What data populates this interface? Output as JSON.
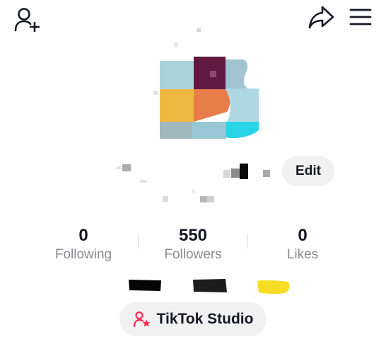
{
  "header": {
    "add_friend_icon": "person-plus-icon",
    "share_icon": "share-arrow-icon",
    "menu_icon": "hamburger-menu-icon"
  },
  "profile": {
    "edit_label": "Edit"
  },
  "stats": [
    {
      "value": "0",
      "label": "Following"
    },
    {
      "value": "550",
      "label": "Followers"
    },
    {
      "value": "0",
      "label": "Likes"
    }
  ],
  "studio": {
    "label": "TikTok Studio",
    "icon": "person-star-icon",
    "accent": "#fe2c55"
  }
}
